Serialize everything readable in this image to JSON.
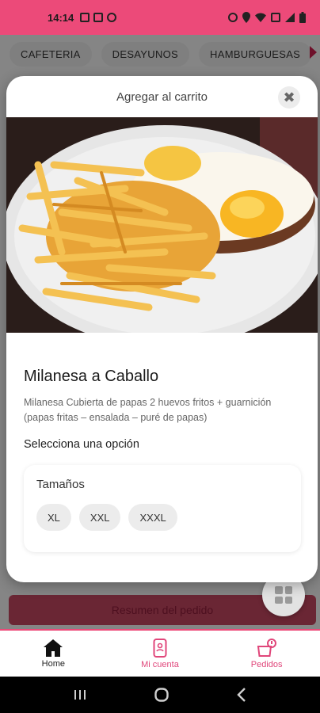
{
  "status_bar": {
    "time": "14:14"
  },
  "categories": [
    "CAFETERIA",
    "DESAYUNOS",
    "HAMBURGUESAS"
  ],
  "summary_button": "Resumen del pedido",
  "modal": {
    "title": "Agregar al carrito",
    "close_symbol": "✖",
    "dish_name": "Milanesa a Caballo",
    "description": "Milanesa Cubierta de papas 2 huevos fritos + guarnición (papas fritas – ensalada – puré de papas)",
    "select_label": "Selecciona una opción",
    "options_title": "Tamaños",
    "sizes": [
      "XL",
      "XXL",
      "XXXL"
    ]
  },
  "bottom_nav": {
    "home": "Home",
    "account": "Mi cuenta",
    "orders": "Pedidos"
  },
  "colors": {
    "brand": "#ec4a79",
    "accent": "#c81e4e"
  }
}
